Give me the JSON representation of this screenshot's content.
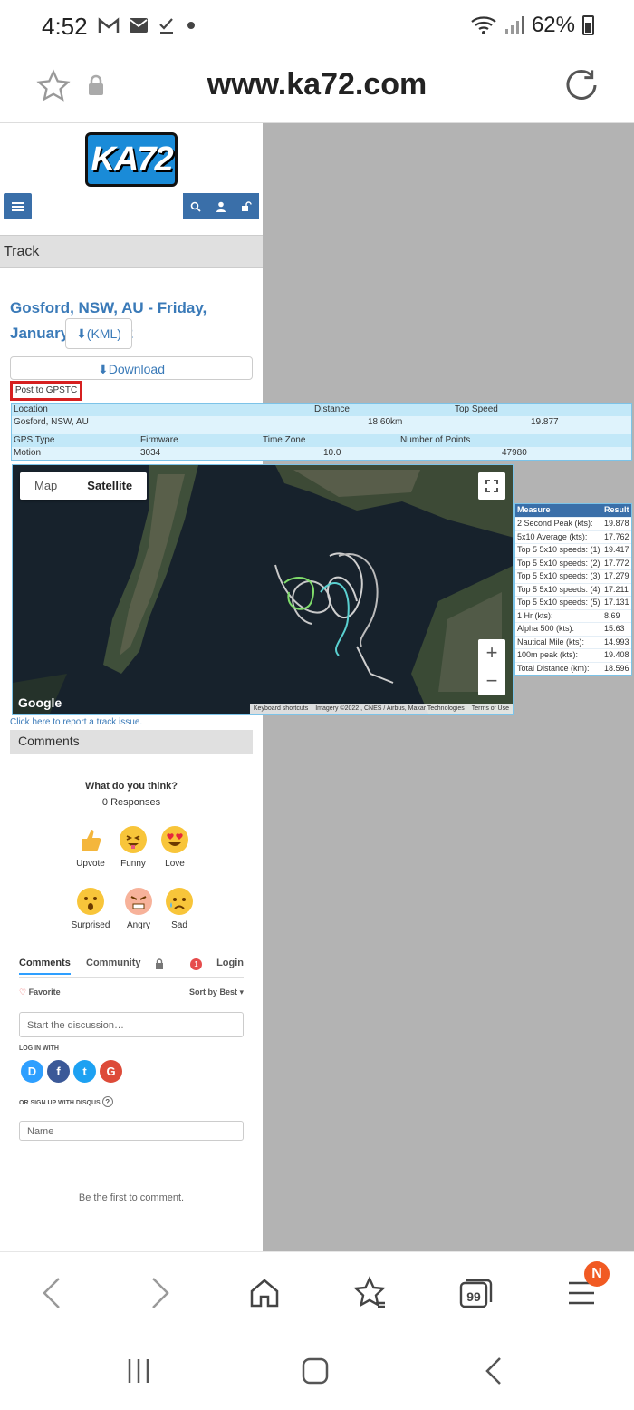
{
  "status": {
    "time": "4:52",
    "battery": "62%",
    "icons": [
      "gmail-icon",
      "mail-icon",
      "check-icon",
      "dot-icon",
      "wifi-icon",
      "signal-icon",
      "battery-icon"
    ]
  },
  "browser": {
    "url": "www.ka72.com"
  },
  "site": {
    "logo": "KA72",
    "section_title": "Track"
  },
  "track": {
    "title": "Gosford, NSW, AU - Friday, January 14, 2022",
    "kml_label": "(KML)",
    "download_label": "Download",
    "gpstc_label": "Post to GPSTC"
  },
  "info": {
    "row1_headers": [
      "Location",
      "Distance",
      "Top Speed"
    ],
    "row1_values": [
      "Gosford, NSW, AU",
      "18.60km",
      "19.877"
    ],
    "row2_headers": [
      "GPS Type",
      "Firmware",
      "Time Zone",
      "Number of Points"
    ],
    "row2_values": [
      "Motion",
      "3034",
      "10.0",
      "47980"
    ]
  },
  "map": {
    "map_label": "Map",
    "satellite_label": "Satellite",
    "zoom_in": "+",
    "zoom_out": "−",
    "google": "Google",
    "attr_shortcuts": "Keyboard shortcuts",
    "attr_imagery": "Imagery ©2022 , CNES / Airbus, Maxar Technologies",
    "attr_terms": "Terms of Use"
  },
  "results": {
    "header_measure": "Measure",
    "header_result": "Result",
    "rows": [
      {
        "measure": "2 Second Peak (kts):",
        "value": "19.878"
      },
      {
        "measure": "5x10 Average (kts):",
        "value": "17.762"
      },
      {
        "measure": "Top 5 5x10 speeds: (1)",
        "value": "19.417"
      },
      {
        "measure": "Top 5 5x10 speeds: (2)",
        "value": "17.772"
      },
      {
        "measure": "Top 5 5x10 speeds: (3)",
        "value": "17.279"
      },
      {
        "measure": "Top 5 5x10 speeds: (4)",
        "value": "17.211"
      },
      {
        "measure": "Top 5 5x10 speeds: (5)",
        "value": "17.131"
      },
      {
        "measure": "1 Hr (kts):",
        "value": "8.69"
      },
      {
        "measure": "Alpha 500 (kts):",
        "value": "15.63"
      },
      {
        "measure": "Nautical Mile (kts):",
        "value": "14.993"
      },
      {
        "measure": "100m peak (kts):",
        "value": "19.408"
      },
      {
        "measure": "Total Distance (km):",
        "value": "18.596"
      }
    ]
  },
  "report_link": "Click here to report a track issue.",
  "comments": {
    "title": "Comments",
    "prompt": "What do you think?",
    "responses": "0 Responses",
    "reactions": [
      "Upvote",
      "Funny",
      "Love",
      "Surprised",
      "Angry",
      "Sad"
    ],
    "tab_comments": "Comments",
    "tab_community": "Community",
    "login": "Login",
    "login_badge": "1",
    "favorite": "Favorite",
    "sort": "Sort by Best",
    "start_placeholder": "Start the discussion…",
    "login_with": "LOG IN WITH",
    "social": [
      "D",
      "f",
      "t",
      "G"
    ],
    "signup": "OR SIGN UP WITH DISQUS",
    "name_placeholder": "Name",
    "first_comment": "Be the first to comment."
  },
  "toolbar": {
    "badge": "N"
  },
  "colors": {
    "link_blue": "#3a7ab8",
    "nav_blue": "#3a6fa9",
    "table_border": "#7cc3e8",
    "badge_orange": "#f15a23"
  }
}
